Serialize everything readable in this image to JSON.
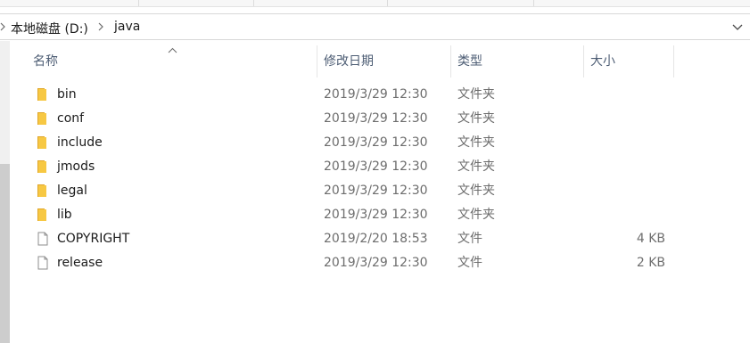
{
  "breadcrumb": {
    "drive": "本地磁盘 (D:)",
    "folder": "java"
  },
  "columns": {
    "name": "名称",
    "date": "修改日期",
    "type": "类型",
    "size": "大小"
  },
  "files": [
    {
      "name": "bin",
      "date": "2019/3/29 12:30",
      "type": "文件夹",
      "size": "",
      "icon": "folder-icon"
    },
    {
      "name": "conf",
      "date": "2019/3/29 12:30",
      "type": "文件夹",
      "size": "",
      "icon": "folder-icon"
    },
    {
      "name": "include",
      "date": "2019/3/29 12:30",
      "type": "文件夹",
      "size": "",
      "icon": "folder-icon"
    },
    {
      "name": "jmods",
      "date": "2019/3/29 12:30",
      "type": "文件夹",
      "size": "",
      "icon": "folder-icon"
    },
    {
      "name": "legal",
      "date": "2019/3/29 12:30",
      "type": "文件夹",
      "size": "",
      "icon": "folder-icon"
    },
    {
      "name": "lib",
      "date": "2019/3/29 12:30",
      "type": "文件夹",
      "size": "",
      "icon": "folder-icon"
    },
    {
      "name": "COPYRIGHT",
      "date": "2019/2/20 18:53",
      "type": "文件",
      "size": "4 KB",
      "icon": "file-icon"
    },
    {
      "name": "release",
      "date": "2019/3/29 12:30",
      "type": "文件",
      "size": "2 KB",
      "icon": "file-icon"
    }
  ],
  "colors": {
    "folder": "#f7c843",
    "header_text": "#4d5d74",
    "secondary_text": "#6d6d6d"
  }
}
